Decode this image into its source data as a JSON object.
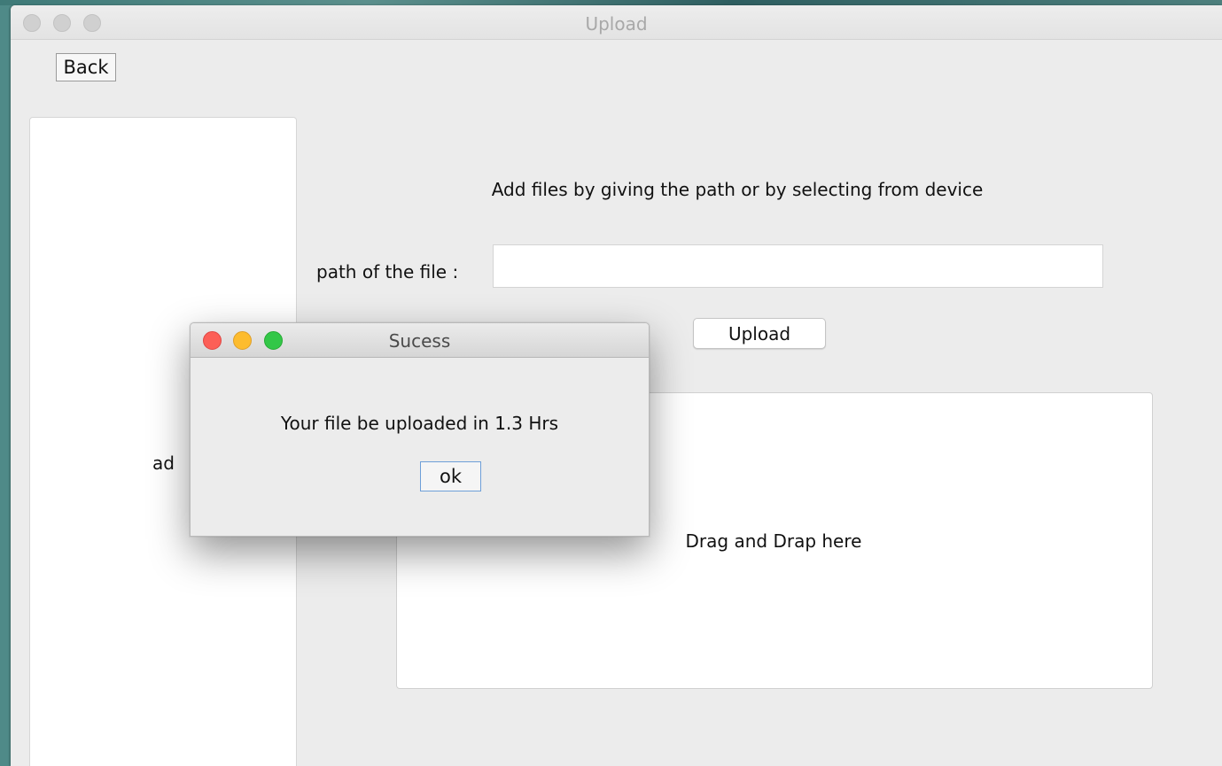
{
  "window": {
    "title": "Upload",
    "back_label": "Back"
  },
  "sidebar": {
    "partial_label": "ad"
  },
  "main": {
    "instructions": "Add files by giving the path or by selecting from device",
    "path_label": "path of the file :",
    "path_value": "",
    "upload_label": "Upload",
    "drop_zone_label": "Drag and Drap here"
  },
  "dialog": {
    "title": "Sucess",
    "message": "Your file be uploaded in 1.3 Hrs",
    "ok_label": "ok"
  },
  "colors": {
    "desktop": "#4f8a88",
    "window_bg": "#ececec",
    "close": "#fc5f57",
    "minimize": "#fdbc2e",
    "maximize": "#33c748",
    "focus_ring": "#6e9fd8"
  }
}
